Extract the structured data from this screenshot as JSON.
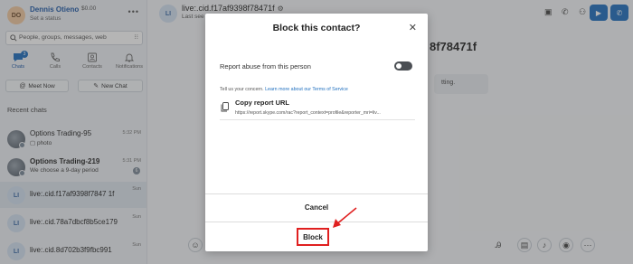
{
  "sidebar": {
    "profile": {
      "initials": "DO",
      "name": "Dennis Otieno",
      "credit": "$0.00",
      "status": "Set a status"
    },
    "search": {
      "placeholder": "People, groups, messages, web"
    },
    "tabs": [
      {
        "label": "Chats",
        "badge": "3"
      },
      {
        "label": "Calls"
      },
      {
        "label": "Contacts"
      },
      {
        "label": "Notifications"
      }
    ],
    "meet_now": "Meet Now",
    "new_chat": "New Chat",
    "recent_header": "Recent chats",
    "chats": [
      {
        "title": "Options Trading-95",
        "subtitle": "photo",
        "time": "5:32 PM"
      },
      {
        "title": "Options Trading-219",
        "subtitle": "We choose a 9-day period",
        "time": "5:31 PM",
        "unread": "6"
      },
      {
        "initials": "LI",
        "title": "live:.cid.f17af9398f7847 1f",
        "time": "Sun"
      },
      {
        "initials": "LI",
        "title": "live:.cid.78a7dbcf8b5ce179",
        "time": "Sun"
      },
      {
        "initials": "LI",
        "title": "live:.cid.8d702b3f9fbc991",
        "time": "Sun"
      }
    ]
  },
  "main": {
    "contact_initials": "LI",
    "contact_title": "live:.cid.f17af9398f78471f",
    "last_seen": "Last see",
    "big_title": "8f78471f",
    "ghost_message": "tting."
  },
  "dialog": {
    "title": "Block this contact?",
    "report_label": "Report abuse from this person",
    "concern_text": "Tell us your concern.",
    "concern_link": "Learn more about our Terms of Service",
    "copy_title": "Copy report URL",
    "copy_url": "https://report.skype.com/rac?report_context=profile&reporter_mri=liv...",
    "cancel": "Cancel",
    "block": "Block"
  },
  "colors": {
    "accent": "#1f6fbf",
    "highlight": "#e02020"
  }
}
